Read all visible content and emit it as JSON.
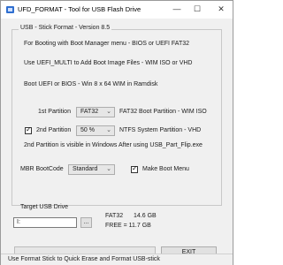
{
  "window": {
    "title": "UFD_FORMAT - Tool for USB Flash Drive",
    "controls": {
      "minimize": "—",
      "maximize": "☐",
      "close": "✕"
    }
  },
  "group": {
    "title": "USB - Stick  Format - Version 8.5"
  },
  "info_lines": [
    "For Booting with Boot Manager menu -  BIOS  or  UEFI  FAT32",
    "Use  UEFI_MULTI to Add Boot Image Files - WIM  ISO or VHD",
    "Boot UEFI  or  BIOS - Win 8 x 64 WIM in Ramdisk"
  ],
  "partition1": {
    "label": "1st Partition",
    "value": "FAT32",
    "desc": "FAT32  Boot  Partition - WIM  ISO"
  },
  "partition2": {
    "label": "2nd Partition",
    "checked": true,
    "value": "50 %",
    "desc": "NTFS  System  Partition - VHD"
  },
  "partition2_note": "2nd Partition  is visible in Windows After using USB_Part_Flip.exe",
  "mbr": {
    "label": "MBR BootCode",
    "value": "Standard",
    "boot_menu_label": "Make Boot Menu",
    "boot_menu_checked": true
  },
  "target": {
    "label": "Target USB Drive",
    "drive_value": "I:",
    "browse_label": "...",
    "fs": "FAT32",
    "size": "14.6 GB",
    "free": "FREE  =  11.7 GB"
  },
  "progress": {
    "fraction": 0.0
  },
  "buttons": {
    "exit": "EXIT"
  },
  "status": "Use Format Stick to Quick Erase and Format USB-stick"
}
